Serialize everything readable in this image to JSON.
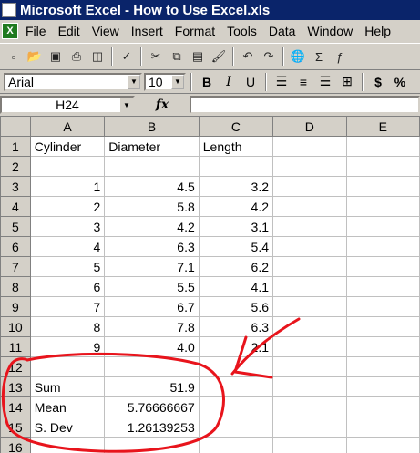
{
  "window": {
    "title": "Microsoft Excel - How to Use Excel.xls"
  },
  "menu": [
    "File",
    "Edit",
    "View",
    "Insert",
    "Format",
    "Tools",
    "Data",
    "Window",
    "Help"
  ],
  "toolbar": {
    "icons": [
      "new-icon",
      "open-icon",
      "save-icon",
      "print-icon",
      "print-preview-icon",
      "spelling-icon",
      "cut-icon",
      "copy-icon",
      "paste-icon",
      "format-painter-icon",
      "undo-icon",
      "redo-icon",
      "hyperlink-icon",
      "autosum-icon",
      "function-icon"
    ]
  },
  "format": {
    "font": "Arial",
    "size": "10",
    "bold": "B",
    "italic": "I",
    "underline": "U",
    "currency": "$",
    "percent": "%"
  },
  "formula_bar": {
    "cell_ref": "H24",
    "fx": "fx",
    "content": ""
  },
  "sheet": {
    "columns": [
      "A",
      "B",
      "C",
      "D",
      "E"
    ],
    "rows": [
      {
        "num": "1",
        "cells": [
          "Cylinder",
          "Diameter",
          "Length",
          "",
          ""
        ]
      },
      {
        "num": "2",
        "cells": [
          "",
          "",
          "",
          "",
          ""
        ]
      },
      {
        "num": "3",
        "cells": [
          "1",
          "4.5",
          "3.2",
          "",
          ""
        ]
      },
      {
        "num": "4",
        "cells": [
          "2",
          "5.8",
          "4.2",
          "",
          ""
        ]
      },
      {
        "num": "5",
        "cells": [
          "3",
          "4.2",
          "3.1",
          "",
          ""
        ]
      },
      {
        "num": "6",
        "cells": [
          "4",
          "6.3",
          "5.4",
          "",
          ""
        ]
      },
      {
        "num": "7",
        "cells": [
          "5",
          "7.1",
          "6.2",
          "",
          ""
        ]
      },
      {
        "num": "8",
        "cells": [
          "6",
          "5.5",
          "4.1",
          "",
          ""
        ]
      },
      {
        "num": "9",
        "cells": [
          "7",
          "6.7",
          "5.6",
          "",
          ""
        ]
      },
      {
        "num": "10",
        "cells": [
          "8",
          "7.8",
          "6.3",
          "",
          ""
        ]
      },
      {
        "num": "11",
        "cells": [
          "9",
          "4.0",
          "2.1",
          "",
          ""
        ]
      },
      {
        "num": "12",
        "cells": [
          "",
          "",
          "",
          "",
          ""
        ]
      },
      {
        "num": "13",
        "cells": [
          "Sum",
          "51.9",
          "",
          "",
          ""
        ]
      },
      {
        "num": "14",
        "cells": [
          "Mean",
          "5.76666667",
          "",
          "",
          ""
        ]
      },
      {
        "num": "15",
        "cells": [
          "S. Dev",
          "1.26139253",
          "",
          "",
          ""
        ]
      },
      {
        "num": "16",
        "cells": [
          "",
          "",
          "",
          "",
          ""
        ]
      }
    ]
  },
  "annotation": {
    "color": "#e8141c"
  }
}
